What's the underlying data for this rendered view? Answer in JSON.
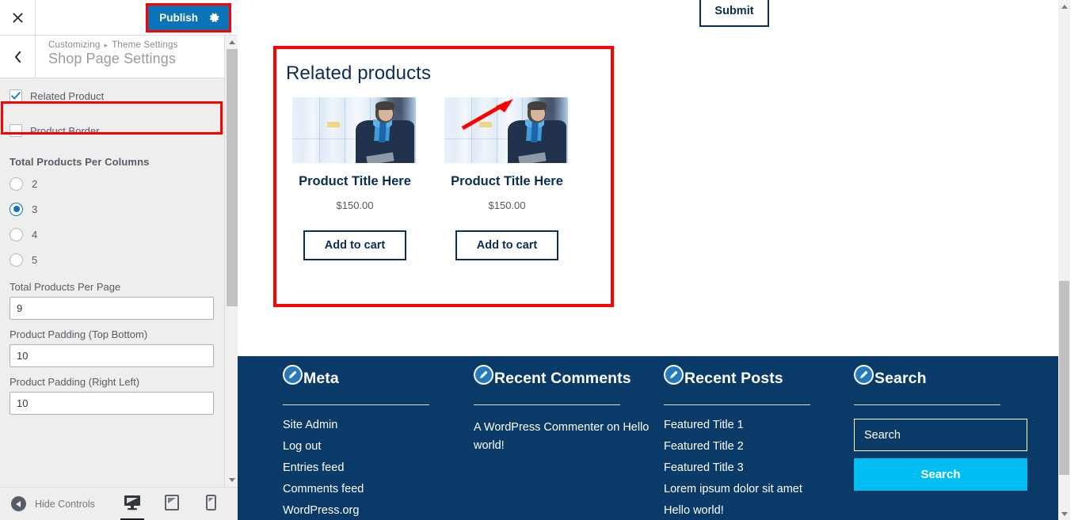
{
  "customizer": {
    "close_icon": "close-icon",
    "publish_label": "Publish",
    "gear_icon": "gear-icon",
    "back_icon": "chevron-left-icon",
    "breadcrumb_root": "Customizing",
    "breadcrumb_sep": "▸",
    "breadcrumb_parent": "Theme Settings",
    "section_title": "Shop Page Settings",
    "checkboxes": [
      {
        "label": "Related Product",
        "checked": true
      },
      {
        "label": "Product Border",
        "checked": false
      }
    ],
    "columns_group": {
      "label": "Total Products Per Columns",
      "options": [
        "2",
        "3",
        "4",
        "5"
      ],
      "selected": "3"
    },
    "fields": [
      {
        "label": "Total Products Per Page",
        "value": "9"
      },
      {
        "label": "Product Padding (Top Bottom)",
        "value": "10"
      },
      {
        "label": "Product Padding (Right Left)",
        "value": "10"
      }
    ],
    "footer": {
      "hide_controls_label": "Hide Controls",
      "devices": [
        {
          "name": "desktop",
          "active": true
        },
        {
          "name": "tablet",
          "active": false
        },
        {
          "name": "mobile",
          "active": false
        }
      ]
    },
    "highlight_color": "#ff0000",
    "accent_color": "#0b74b8"
  },
  "preview": {
    "submit_label": "Submit",
    "related": {
      "heading": "Related products",
      "products": [
        {
          "title": "Product Title Here",
          "price": "$150.00",
          "cart_label": "Add to cart",
          "image": "businessman-photo"
        },
        {
          "title": "Product Title Here",
          "price": "$150.00",
          "cart_label": "Add to cart",
          "image": "businessman-photo"
        }
      ]
    },
    "footer_widgets": [
      {
        "title": "Meta",
        "type": "list",
        "items": [
          "Site Admin",
          "Log out",
          "Entries feed",
          "Comments feed",
          "WordPress.org"
        ]
      },
      {
        "title": "Recent Comments",
        "type": "text",
        "text_prefix": "A WordPress Commenter",
        "text_mid": " on ",
        "text_link": "Hello world!"
      },
      {
        "title": "Recent Posts",
        "type": "list",
        "items": [
          "Featured Title 1",
          "Featured Title 2",
          "Featured Title 3",
          "Lorem ipsum dolor sit amet",
          "Hello world!"
        ]
      },
      {
        "title": "Search",
        "type": "search",
        "placeholder": "Search",
        "button_label": "Search"
      }
    ],
    "footer_bg": "#0a3a68",
    "search_button_color": "#00bdf2",
    "product_text_color": "#0a2d57"
  }
}
